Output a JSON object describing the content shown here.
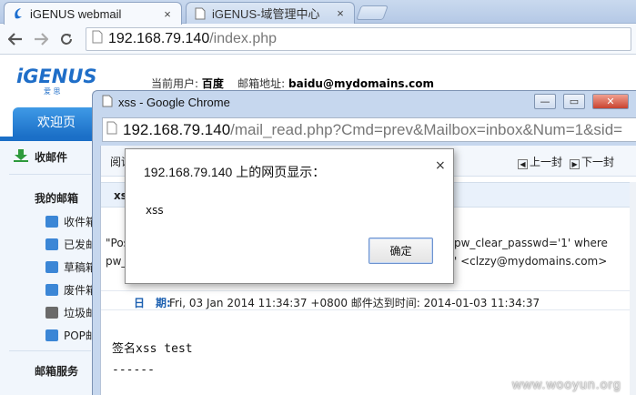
{
  "browser": {
    "tabs": [
      {
        "title": "iGENUS webmail",
        "active": true
      },
      {
        "title": "iGENUS-域管理中心",
        "active": false
      }
    ],
    "tab_close_glyph": "×",
    "url_host": "192.168.79.140",
    "url_path": "/index.php"
  },
  "webmail": {
    "logo_text": "iGENUS",
    "logo_sub": "爱 思",
    "user_label": "当前用户:",
    "user_name": "百度",
    "mail_label": "邮箱地址:",
    "mail_address": "baidu@mydomains.com",
    "welcome_tab": "欢迎页",
    "receive_button": "收邮件",
    "my_mailbox_heading": "我的邮箱",
    "folders": [
      "收件箱",
      "已发邮",
      "草稿箱",
      "废件箱",
      "垃圾邮",
      "POP邮"
    ],
    "folder_colors": [
      "#3b86d6",
      "#3b86d6",
      "#3b86d6",
      "#3b86d6",
      "#6a6a6a",
      "#3b86d6"
    ],
    "service_heading": "邮箱服务"
  },
  "popup": {
    "title": "xss - Google Chrome",
    "url_host": "192.168.79.140",
    "url_path": "/mail_read.php?Cmd=prev&Mailbox=inbox&Num=1&sid=",
    "read_label": "阅读",
    "prev_label": "上一封",
    "next_label": "下一封",
    "subject_label": "xs",
    "sql_left_1": "\"Pos",
    "sql_left_2": "pw_",
    "sql_right_1": "pw_clear_passwd='1' where",
    "sql_right_2": "' <clzzy@mydomains.com>",
    "date_label": "日　期:",
    "date_value": "Fri, 03 Jan 2014 11:34:37 +0800 邮件达到时间: 2014-01-03 11:34:37",
    "body_line_1": "签名xss test",
    "body_line_2": "------"
  },
  "dialog": {
    "title": "192.168.79.140 上的网页显示：",
    "message": "xss",
    "ok_label": "确定",
    "close_glyph": "×"
  },
  "watermark": "www.wooyun.org"
}
